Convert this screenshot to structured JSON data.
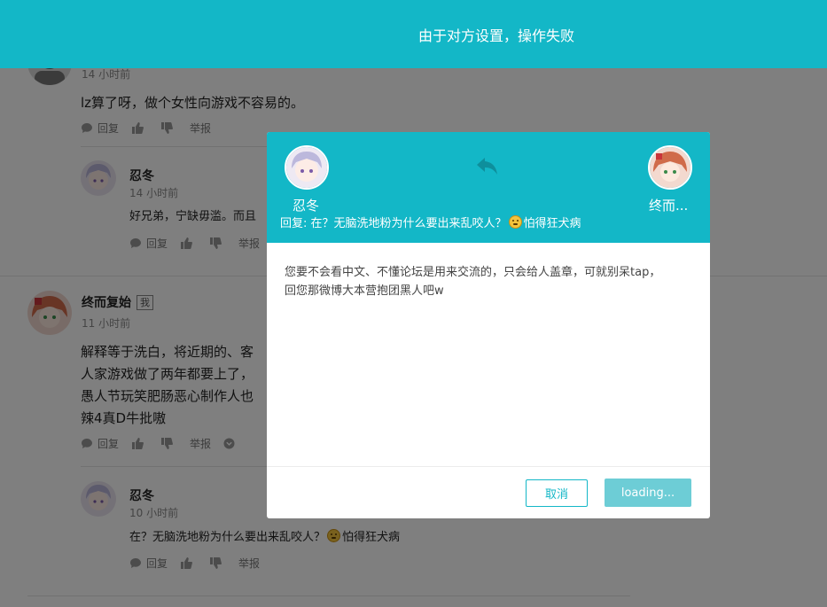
{
  "toast": {
    "message": "由于对方设置，操作失败"
  },
  "actions": {
    "reply": "回复",
    "report": "举报"
  },
  "thread": {
    "c1": {
      "time": "14 小时前",
      "text": "lz算了呀，做个女性向游戏不容易的。"
    },
    "c2": {
      "name": "忍冬",
      "time": "14 小时前",
      "text": "好兄弟，宁缺毋滥。而且"
    },
    "c3": {
      "name": "终而复始",
      "tag": "我",
      "time": "11 小时前",
      "lines": [
        "解释等于洗白，将近期的、客",
        "人家游戏做了两年都要上了，",
        "愚人节玩笑肥肠恶心制作人也",
        "辣4真D牛批嗷"
      ]
    },
    "c4": {
      "name": "忍冬",
      "time": "10 小时前",
      "text_pre": "在？无脑洗地粉为什么要出来乱咬人？",
      "text_post": "怕得狂犬病"
    }
  },
  "dialog": {
    "from_name": "忍冬",
    "to_name": "终而...",
    "quote_pre": "回复: 在？无脑洗地粉为什么要出来乱咬人？",
    "quote_post": "怕得狂犬病",
    "body_line1": "您要不会看中文、不懂论坛是用来交流的，只会给人盖章，可就别呆tap，",
    "body_line2": "回您那微博大本营抱团黑人吧w",
    "cancel_label": "取消",
    "submit_label": "loading..."
  },
  "colors": {
    "accent": "#13b7c7",
    "loading_button": "#6dcdd6"
  },
  "icons": [
    "comment-icon",
    "thumb-up-icon",
    "thumb-down-icon",
    "reply-arrow-icon",
    "chevron-down-icon",
    "emoji-icon"
  ]
}
